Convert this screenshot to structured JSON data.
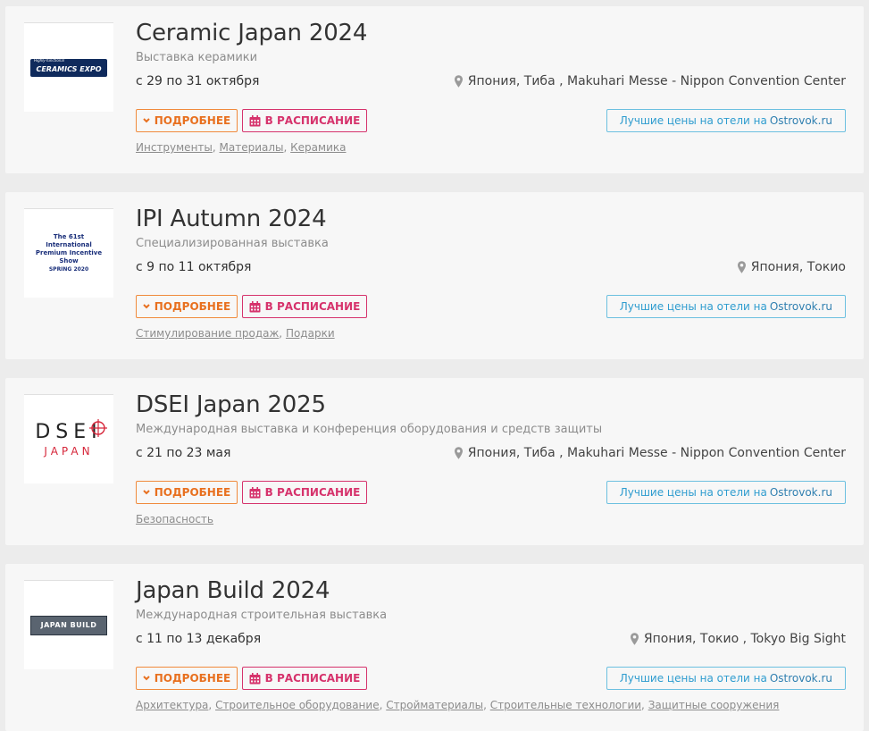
{
  "labels": {
    "more": "ПОДРОБНЕЕ",
    "schedule": "В РАСПИСАНИЕ",
    "hotel_text": "Лучшие цены на отели на",
    "hotel_brand": "Ostrovok.ru"
  },
  "colors": {
    "more_accent": "#e8701f",
    "schedule_accent": "#d6336c",
    "hotel_accent": "#2e9ccf"
  },
  "events": [
    {
      "title": "Ceramic Japan 2024",
      "subtitle": "Выставка керамики",
      "dates": "с 29 по 31 октября",
      "location": "Япония, Тиба , Makuhari Messe - Nippon Convention Center",
      "logo_text": "CERAMICS EXPO",
      "logo_small": "Highly-functional",
      "tags": [
        "Инструменты",
        "Материалы",
        "Керамика"
      ]
    },
    {
      "title": "IPI Autumn 2024",
      "subtitle": "Специализированная выставка",
      "dates": "с 9 по 11 октября",
      "location": "Япония, Токио",
      "logo_text": "The 61st International Premium Incentive Show",
      "logo_small": "SPRING 2020",
      "tags": [
        "Стимулирование продаж",
        "Подарки"
      ]
    },
    {
      "title": "DSEI Japan 2025",
      "subtitle": "Международная выставка и конференция оборудования и средств защиты",
      "dates": "с 21 по 23 мая",
      "location": "Япония, Тиба , Makuhari Messe - Nippon Convention Center",
      "logo_text": "DSEI",
      "logo_small": "JAPAN",
      "tags": [
        "Безопасность"
      ]
    },
    {
      "title": "Japan Build 2024",
      "subtitle": "Международная строительная выставка",
      "dates": "с 11 по 13 декабря",
      "location": "Япония, Токио , Tokyo Big Sight",
      "logo_text": "JAPAN BUILD",
      "logo_small": "",
      "tags": [
        "Архитектура",
        "Строительное оборудование",
        "Стройматериалы",
        "Строительные технологии",
        "Защитные сооружения"
      ]
    }
  ]
}
